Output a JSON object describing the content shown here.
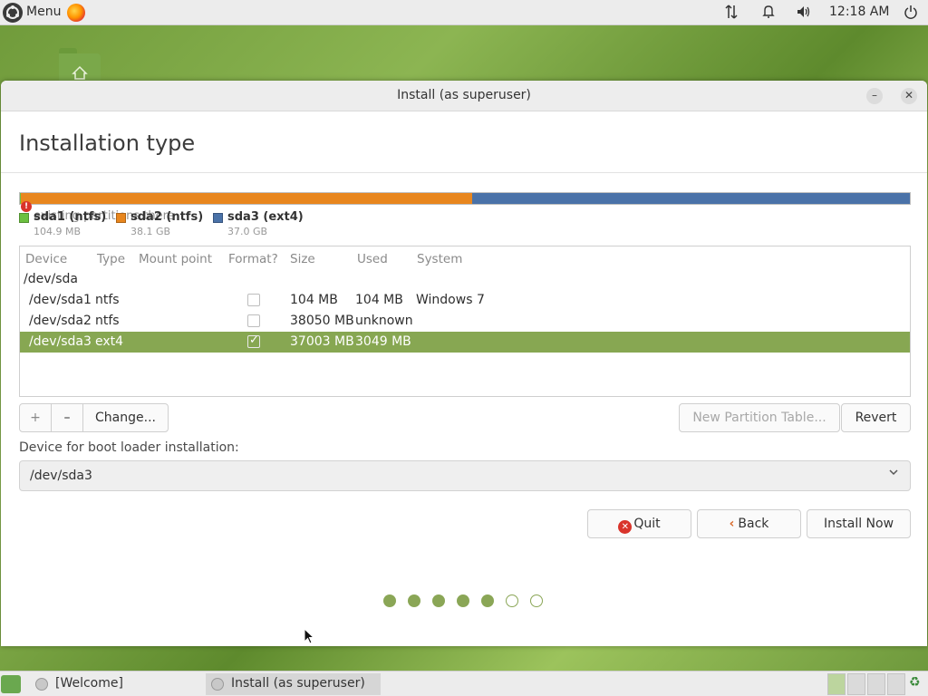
{
  "top_panel": {
    "menu_label": "Menu",
    "clock": "12:18 AM"
  },
  "window": {
    "title": "Install (as superuser)",
    "heading": "Installation type",
    "ghost_text": "existing partitions there"
  },
  "partition_bar": {
    "segments": [
      {
        "name": "sda1 (ntfs)",
        "size": "104.9 MB",
        "color": "#6cc040"
      },
      {
        "name": "sda2 (ntfs)",
        "size": "38.1 GB",
        "color": "#e8861e"
      },
      {
        "name": "sda3 (ext4)",
        "size": "37.0 GB",
        "color": "#4a72a8"
      }
    ]
  },
  "table": {
    "headers": [
      "Device",
      "Type",
      "Mount point",
      "Format?",
      "Size",
      "Used",
      "System"
    ],
    "disk": "/dev/sda",
    "rows": [
      {
        "device": "/dev/sda1",
        "type": "ntfs",
        "mount": "",
        "format": false,
        "size": "104 MB",
        "used": "104 MB",
        "system": "Windows 7"
      },
      {
        "device": "/dev/sda2",
        "type": "ntfs",
        "mount": "",
        "format": false,
        "size": "38050 MB",
        "used": "unknown",
        "system": ""
      },
      {
        "device": "/dev/sda3",
        "type": "ext4",
        "mount": "",
        "format": true,
        "size": "37003 MB",
        "used": "3049 MB",
        "system": ""
      }
    ],
    "selected_row": 2
  },
  "toolbar": {
    "add_label": "+",
    "remove_label": "–",
    "change_label": "Change...",
    "new_table_label": "New Partition Table...",
    "revert_label": "Revert"
  },
  "bootloader": {
    "label": "Device for boot loader installation:",
    "value": "/dev/sda3"
  },
  "actions": {
    "quit_label": "Quit",
    "back_label": "Back",
    "install_label": "Install Now"
  },
  "progress": {
    "total_steps": 7,
    "completed_steps": 5
  },
  "taskbar": {
    "tasks": [
      {
        "label": "[Welcome]",
        "active": false
      },
      {
        "label": "Install (as superuser)",
        "active": true
      }
    ]
  },
  "colors": {
    "accent": "#87a752",
    "partition_sda1": "#6cc040",
    "partition_sda2": "#e8861e",
    "partition_sda3": "#4a72a8",
    "error": "#d9342b"
  }
}
